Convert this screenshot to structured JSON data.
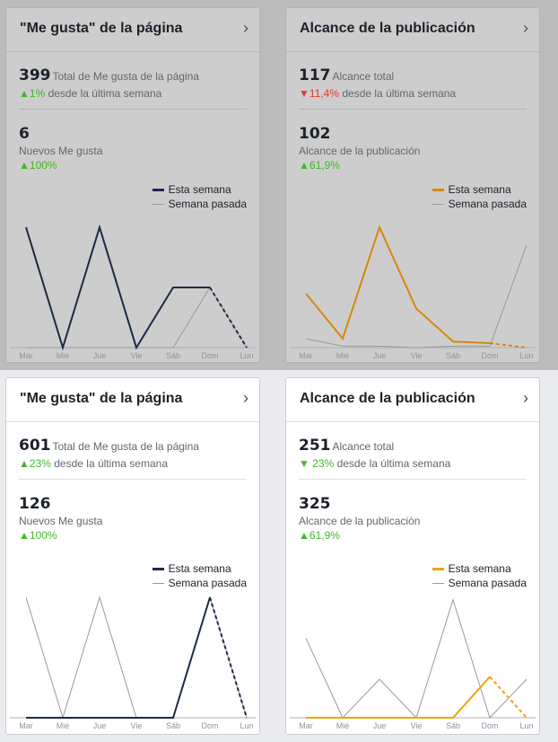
{
  "cards": [
    {
      "title": "\"Me gusta\" de la página",
      "stat1_value": "399",
      "stat1_label": "Total de Me gusta de la página",
      "stat1_delta_value": "1%",
      "stat1_delta_suffix": " desde la última semana",
      "stat1_delta_direction": "up",
      "stat2_value": "6",
      "stat2_label": "Nuevos Me gusta",
      "stat2_delta_value": "100%",
      "legend_this": "Esta semana",
      "legend_last": "Semana pasada",
      "this_color": "#1c2a48"
    },
    {
      "title": "Alcance de la publicación",
      "stat1_value": "117",
      "stat1_label": "Alcance total",
      "stat1_delta_value": "11,4%",
      "stat1_delta_suffix": " desde la última semana",
      "stat1_delta_direction": "down",
      "stat2_value": "102",
      "stat2_label": "Alcance de la publicación",
      "stat2_delta_value": "61,9%",
      "legend_this": "Esta semana",
      "legend_last": "Semana pasada",
      "this_color": "#d9860e"
    },
    {
      "title": "\"Me gusta\" de la página",
      "stat1_value": "601",
      "stat1_label": "Total de Me gusta de la página",
      "stat1_delta_value": "23%",
      "stat1_delta_suffix": " desde la última semana",
      "stat1_delta_direction": "up",
      "stat2_value": "126",
      "stat2_label": "Nuevos Me gusta",
      "stat2_delta_value": "100%",
      "legend_this": "Esta semana",
      "legend_last": "Semana pasada",
      "this_color": "#1c2a48"
    },
    {
      "title": "Alcance de la publicación",
      "stat1_value": "251",
      "stat1_label": "Alcance total",
      "stat1_delta_value": " 23%",
      "stat1_delta_suffix": " desde la última semana",
      "stat1_delta_direction": "down-green",
      "stat2_value": "325",
      "stat2_label": "Alcance de la publicación",
      "stat2_delta_value": "61,9%",
      "legend_this": "Esta semana",
      "legend_last": "Semana pasada",
      "this_color": "#f0a30a"
    }
  ],
  "chart_data": [
    {
      "type": "line",
      "categories": [
        "Mar",
        "Mié",
        "Jue",
        "Vie",
        "Sáb",
        "Dom",
        "Lun"
      ],
      "ylim": [
        0,
        4
      ],
      "series": [
        {
          "name": "Esta semana",
          "values": [
            4,
            0,
            4,
            0,
            2,
            2,
            0
          ],
          "color": "#1c2a48",
          "dashed_last": true
        },
        {
          "name": "Semana pasada",
          "values": [
            0,
            0,
            0,
            0,
            0,
            2,
            0
          ],
          "color": "#9a9a9a"
        }
      ]
    },
    {
      "type": "line",
      "categories": [
        "Mar",
        "Mié",
        "Jue",
        "Vie",
        "Sáb",
        "Dom",
        "Lun"
      ],
      "ylim": [
        0,
        40
      ],
      "series": [
        {
          "name": "Esta semana",
          "values": [
            18,
            3,
            40,
            13,
            2,
            1.5,
            0
          ],
          "color": "#d9860e",
          "dashed_last": true
        },
        {
          "name": "Semana pasada",
          "values": [
            3,
            0.5,
            0.5,
            0,
            0.5,
            0.5,
            34
          ],
          "color": "#9a9a9a"
        }
      ]
    },
    {
      "type": "line",
      "categories": [
        "Mar",
        "Mié",
        "Jue",
        "Vie",
        "Sáb",
        "Dom",
        "Lun"
      ],
      "ylim": [
        0,
        4
      ],
      "series": [
        {
          "name": "Esta semana",
          "values": [
            0,
            0,
            0,
            0,
            0,
            4,
            0
          ],
          "color": "#1c2a48",
          "dashed_last": true
        },
        {
          "name": "Semana pasada",
          "values": [
            4,
            0,
            4,
            0,
            0,
            4,
            0
          ],
          "color": "#9a9a9a"
        }
      ]
    },
    {
      "type": "line",
      "categories": [
        "Mar",
        "Mié",
        "Jue",
        "Vie",
        "Sáb",
        "Dom",
        "Lun"
      ],
      "ylim": [
        0,
        50
      ],
      "series": [
        {
          "name": "Esta semana",
          "values": [
            0,
            0,
            0,
            0,
            0,
            17,
            0
          ],
          "color": "#f0a30a",
          "dashed_last": true
        },
        {
          "name": "Semana pasada",
          "values": [
            33,
            0,
            16,
            0,
            49,
            0,
            16
          ],
          "color": "#9a9a9a"
        }
      ]
    }
  ]
}
